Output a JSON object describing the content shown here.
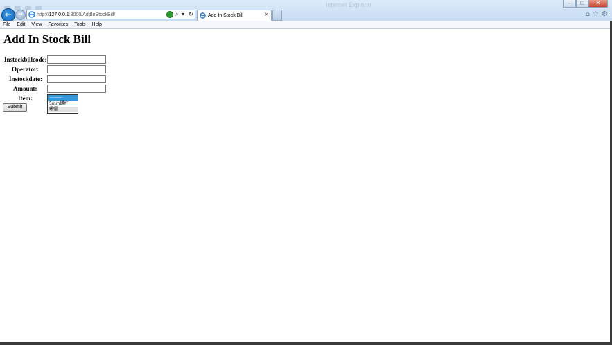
{
  "browser": {
    "window_title": "Internet Explorer",
    "address": {
      "url_prefix": "http://",
      "url_host": "127.0.0.1",
      "url_rest": ":8000/AddInStockBill/"
    },
    "tab": {
      "title": "Add In Stock Bill"
    },
    "menu": [
      "File",
      "Edit",
      "View",
      "Favorites",
      "Tools",
      "Help"
    ]
  },
  "page": {
    "title": "Add In Stock Bill",
    "fields": [
      {
        "label": "Instockbillcode:",
        "value": ""
      },
      {
        "label": "Operator:",
        "value": ""
      },
      {
        "label": "Instockdate:",
        "value": ""
      },
      {
        "label": "Amount:",
        "value": ""
      }
    ],
    "item": {
      "label": "Item:",
      "options": [
        "---------",
        "5mm螺杆",
        "螺帽"
      ]
    },
    "submit_label": "Submit"
  },
  "colors": {
    "accent": "#3399dd",
    "chrome": "#dcebf9",
    "back_button": "#1f7fd6"
  }
}
